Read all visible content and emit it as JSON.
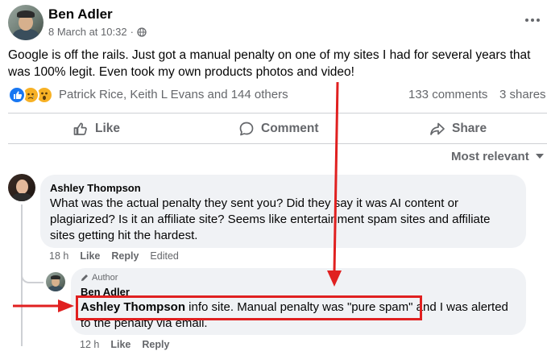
{
  "post": {
    "author": "Ben Adler",
    "timestamp": "8 March at 10:32",
    "separator": "·",
    "privacy_icon": "globe-icon",
    "more_icon": "more-horizontal-icon",
    "text": "Google is off the rails. Just got a manual penalty on one of my sites I had for several years that was 100% legit. Even took my own products photos and video!"
  },
  "stats": {
    "reaction_icons": [
      "like-icon",
      "sad-icon",
      "wow-icon"
    ],
    "reactors": "Patrick Rice, Keith L Evans and 144 others",
    "comments": "133 comments",
    "shares": "3 shares"
  },
  "actions": {
    "like": "Like",
    "comment": "Comment",
    "share": "Share"
  },
  "sort": {
    "label": "Most relevant",
    "icon": "caret-down-icon"
  },
  "comments": [
    {
      "author": "Ashley Thompson",
      "text": "What was the actual penalty they sent you? Did they say it was AI content or plagiarized? Is it an affiliate site? Seems like entertainment spam sites and affiliate sites getting hit the hardest.",
      "time": "18 h",
      "like": "Like",
      "reply": "Reply",
      "edited": "Edited"
    }
  ],
  "reply": {
    "badge": "Author",
    "badge_icon": "pencil-icon",
    "author": "Ben Adler",
    "mention": "Ashley Thompson",
    "text_highlight_rest": " info site. Manual penalty was \"pure spam\"",
    "text_rest": " and I was alerted to the penalty via email.",
    "time": "12 h",
    "like": "Like",
    "reply": "Reply"
  },
  "colors": {
    "annotation_red": "#e02020",
    "like_blue": "#1877f2",
    "muted_text": "#65676b",
    "bubble_bg": "#f0f2f5"
  }
}
